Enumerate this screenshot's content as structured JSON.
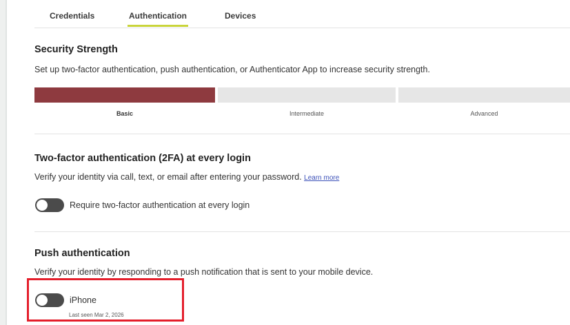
{
  "tabs": [
    {
      "label": "Credentials",
      "active": false
    },
    {
      "label": "Authentication",
      "active": true
    },
    {
      "label": "Devices",
      "active": false
    }
  ],
  "security_strength": {
    "title": "Security Strength",
    "description": "Set up two-factor authentication, push authentication, or Authenticator App to increase security strength.",
    "levels": [
      "Basic",
      "Intermediate",
      "Advanced"
    ],
    "current_level": "Basic",
    "bar_color": "#8e3a3f"
  },
  "two_factor": {
    "title": "Two-factor authentication (2FA) at every login",
    "description": "Verify your identity via call, text, or email after entering your password.",
    "learn_more": "Learn more",
    "toggle_label": "Require two-factor authentication at every login",
    "enabled": false
  },
  "push": {
    "title": "Push authentication",
    "description": "Verify your identity by responding to a push notification that is sent to your mobile device.",
    "device_name": "iPhone",
    "last_seen": "Last seen Mar 2, 2026",
    "enabled": false
  },
  "colors": {
    "accent_underline": "#c9d43a",
    "highlight": "#e41e2b",
    "toggle_off": "#4b4b4b",
    "link": "#3a4fb8"
  }
}
